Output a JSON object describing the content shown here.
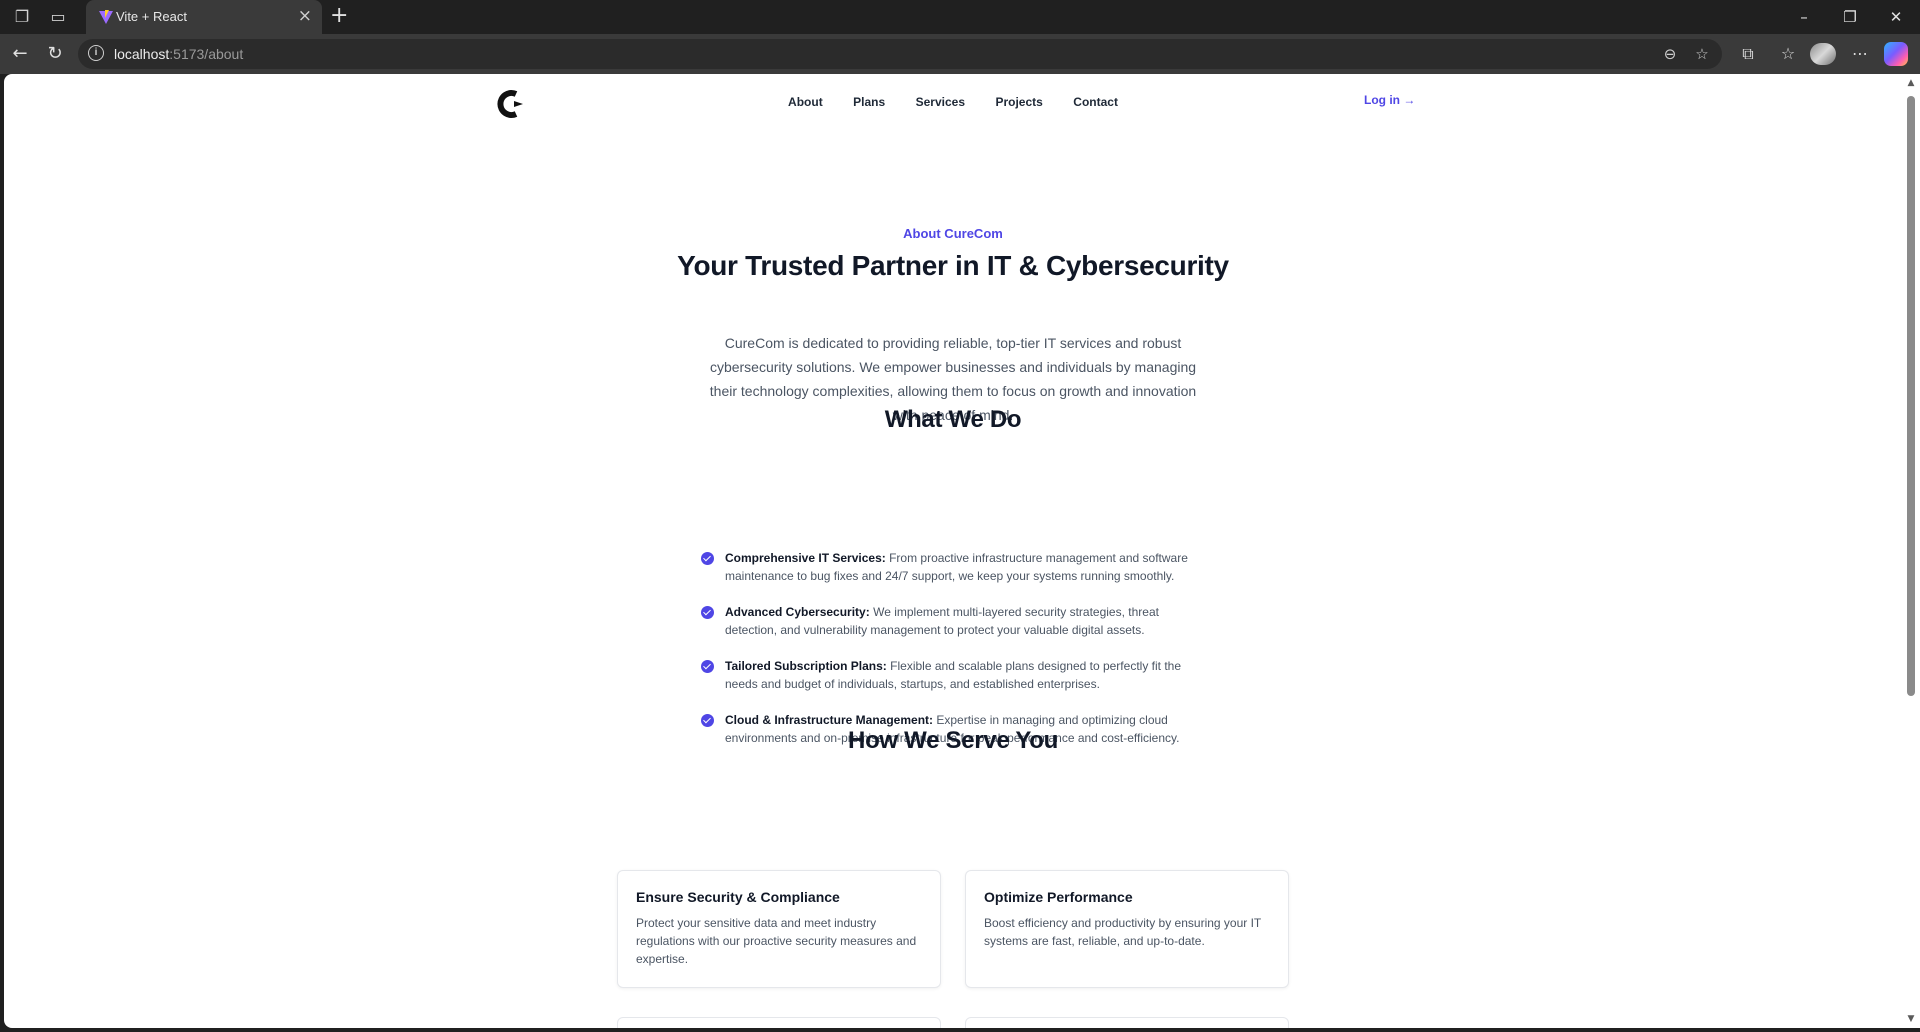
{
  "browser": {
    "tab_title": "Vite + React",
    "url_host": "localhost",
    "url_path": ":5173/about"
  },
  "site": {
    "nav": {
      "links": [
        "About",
        "Plans",
        "Services",
        "Projects",
        "Contact"
      ],
      "login": "Log in →"
    },
    "hero": {
      "eyebrow": "About CureCom",
      "title": "Your Trusted Partner in IT & Cybersecurity",
      "text": "CureCom is dedicated to providing reliable, top-tier IT services and robust cybersecurity solutions. We empower businesses and individuals by managing their technology complexities, allowing them to focus on growth and innovation with peace of mind."
    },
    "what_we_do": {
      "title": "What We Do",
      "items": [
        {
          "term": "Comprehensive IT Services:",
          "desc": "From proactive infrastructure management and software maintenance to bug fixes and 24/7 support, we keep your systems running smoothly."
        },
        {
          "term": "Advanced Cybersecurity:",
          "desc": "We implement multi-layered security strategies, threat detection, and vulnerability management to protect your valuable digital assets."
        },
        {
          "term": "Tailored Subscription Plans:",
          "desc": "Flexible and scalable plans designed to perfectly fit the needs and budget of individuals, startups, and established enterprises."
        },
        {
          "term": "Cloud & Infrastructure Management:",
          "desc": "Expertise in managing and optimizing cloud environments and on-premise infrastructure for peak performance and cost-efficiency."
        }
      ]
    },
    "how_we_serve": {
      "title": "How We Serve You",
      "cards": [
        {
          "title": "Ensure Security & Compliance",
          "text": "Protect your sensitive data and meet industry regulations with our proactive security measures and expertise."
        },
        {
          "title": "Optimize Performance",
          "text": "Boost efficiency and productivity by ensuring your IT systems are fast, reliable, and up-to-date."
        }
      ]
    }
  },
  "colors": {
    "accent": "#4f46e5",
    "heading": "#111827",
    "body_text": "#4b5563"
  }
}
